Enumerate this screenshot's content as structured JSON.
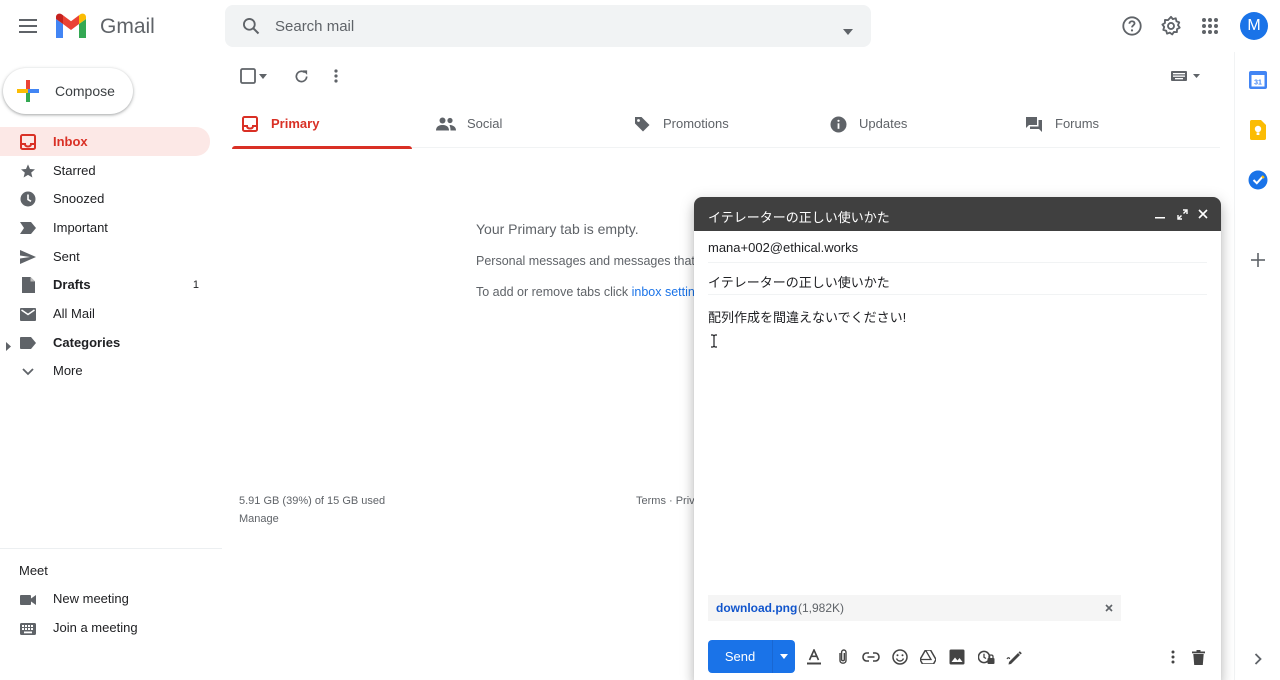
{
  "app": {
    "name": "Gmail"
  },
  "search": {
    "placeholder": "Search mail"
  },
  "user": {
    "initial": "M",
    "color": "#1a73e8"
  },
  "compose_button": {
    "label": "Compose"
  },
  "nav": {
    "items": [
      {
        "label": "Inbox",
        "active": true
      },
      {
        "label": "Starred"
      },
      {
        "label": "Snoozed"
      },
      {
        "label": "Important"
      },
      {
        "label": "Sent"
      },
      {
        "label": "Drafts",
        "count": "1"
      },
      {
        "label": "All Mail"
      },
      {
        "label": "Categories"
      },
      {
        "label": "More"
      }
    ]
  },
  "meet": {
    "title": "Meet",
    "items": [
      {
        "label": "New meeting"
      },
      {
        "label": "Join a meeting"
      }
    ]
  },
  "tabs": [
    {
      "label": "Primary",
      "active": true
    },
    {
      "label": "Social"
    },
    {
      "label": "Promotions"
    },
    {
      "label": "Updates"
    },
    {
      "label": "Forums"
    }
  ],
  "empty_state": {
    "title": "Your Primary tab is empty.",
    "line1": "Personal messages and messages that",
    "line2_prefix": "To add or remove tabs click ",
    "line2_link": "inbox settin"
  },
  "storage": {
    "usage": "5.91 GB (39%) of 15 GB used",
    "manage": "Manage"
  },
  "footer": {
    "links": "Terms · Priv"
  },
  "compose": {
    "title": "イテレーターの正しい使いかた",
    "to": "mana+002@ethical.works",
    "subject": "イテレーターの正しい使いかた",
    "body": "配列作成を間違えないでください!",
    "attachment": {
      "name": "download.png",
      "size": "(1,982K)"
    },
    "send_label": "Send"
  },
  "colors": {
    "accent_red": "#d93025",
    "active_bg": "#fce8e6",
    "send_blue": "#1a73e8",
    "compose_header": "#404040"
  }
}
